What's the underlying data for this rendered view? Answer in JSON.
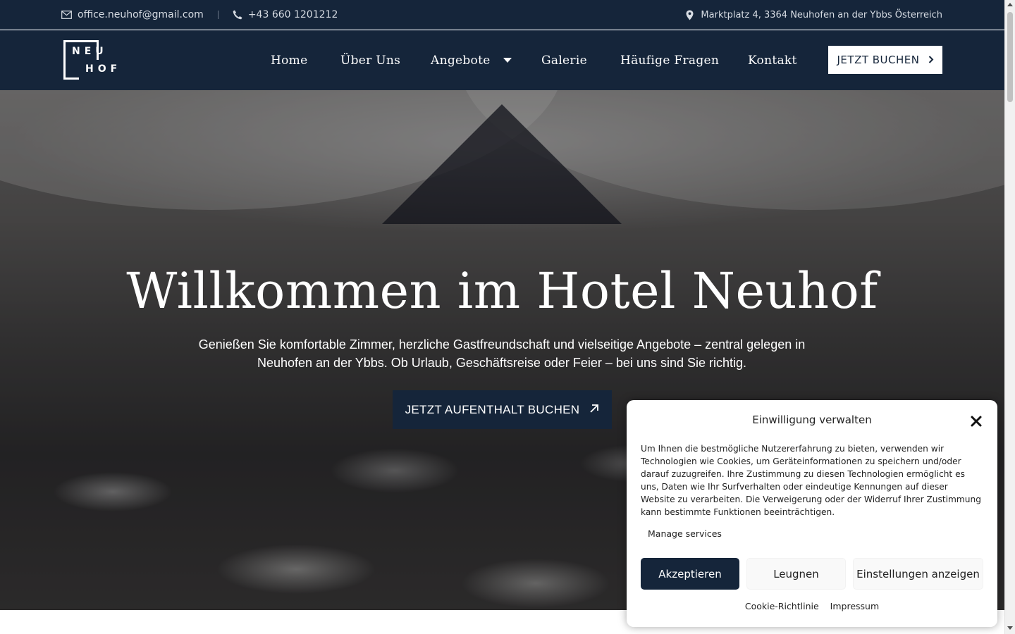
{
  "topbar": {
    "email": "office.neuhof@gmail.com",
    "phone": "+43 660 1201212",
    "address": "Marktplatz 4, 3364 Neuhofen an der Ybbs Österreich",
    "icons": [
      "envelope-icon",
      "phone-icon",
      "map-pin-icon"
    ]
  },
  "nav": {
    "logo_line1": "NEU",
    "logo_line2": "HOF",
    "items": [
      {
        "label": "Home"
      },
      {
        "label": "Über Uns"
      },
      {
        "label": "Angebote"
      },
      {
        "label": "Galerie"
      },
      {
        "label": "Häufige Fragen"
      },
      {
        "label": "Kontakt"
      }
    ],
    "book_label": "JETZT BUCHEN"
  },
  "hero": {
    "title": "Willkommen im Hotel Neuhof",
    "subtitle": "Genießen Sie komfortable Zimmer, herzliche Gastfreundschaft und vielseitige Angebote – zentral gelegen in Neuhofen an der Ybbs. Ob Urlaub, Geschäftsreise oder Feier – bei uns sind Sie richtig.",
    "cta_label": "JETZT AUFENTHALT BUCHEN"
  },
  "cookie": {
    "title": "Einwilligung verwalten",
    "description": "Um Ihnen die bestmögliche Nutzererfahrung zu bieten, verwenden wir Technologien wie Cookies, um Geräteinformationen zu speichern und/oder darauf zuzugreifen. Ihre Zustimmung zu diesen Technologien ermöglicht es uns, Daten wie Ihr Surfverhalten oder eindeutige Kennungen auf dieser Website zu verarbeiten. Die Verweigerung oder der Widerruf Ihrer Zustimmung kann bestimmte Funktionen beeinträchtigen.",
    "manage": "Manage services",
    "accept": "Akzeptieren",
    "deny": "Leugnen",
    "settings": "Einstellungen anzeigen",
    "link_policy": "Cookie-Richtlinie",
    "link_imprint": "Impressum"
  },
  "colors": {
    "navy": "#15253a",
    "white": "#ffffff"
  }
}
